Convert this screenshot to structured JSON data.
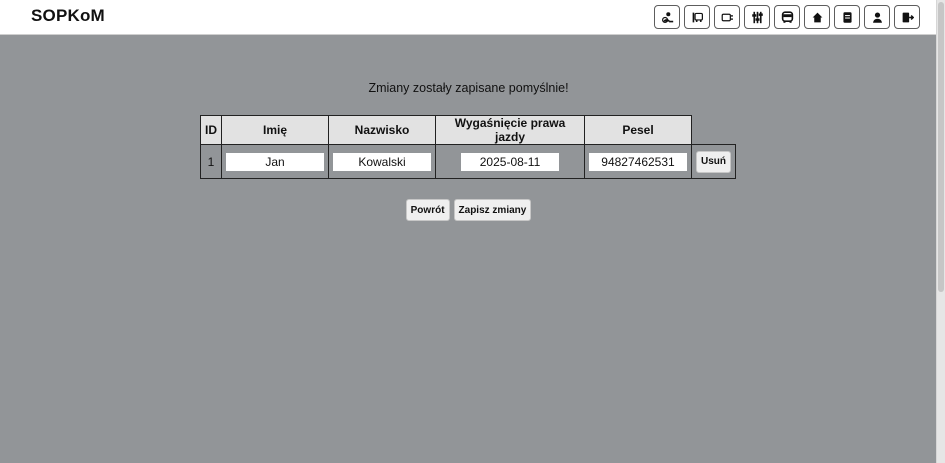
{
  "app": {
    "brand": "SOPKoM"
  },
  "nav": {
    "items": [
      {
        "icon": "driver-icon"
      },
      {
        "icon": "bus-stop-icon"
      },
      {
        "icon": "vehicle-card-icon"
      },
      {
        "icon": "sliders-icon"
      },
      {
        "icon": "bus-icon"
      },
      {
        "icon": "home-icon"
      },
      {
        "icon": "document-icon"
      },
      {
        "icon": "user-icon"
      },
      {
        "icon": "logout-icon"
      }
    ]
  },
  "message": "Zmiany zostały zapisane pomyślnie!",
  "table": {
    "headers": [
      "ID",
      "Imię",
      "Nazwisko",
      "Wygaśnięcie prawa jazdy",
      "Pesel"
    ],
    "rows": [
      {
        "id": "1",
        "first_name": "Jan",
        "last_name": "Kowalski",
        "license_expiry": "2025-08-11",
        "pesel": "94827462531",
        "delete_label": "Usuń"
      }
    ]
  },
  "actions": {
    "back_label": "Powrót",
    "save_label": "Zapisz zmiany"
  }
}
